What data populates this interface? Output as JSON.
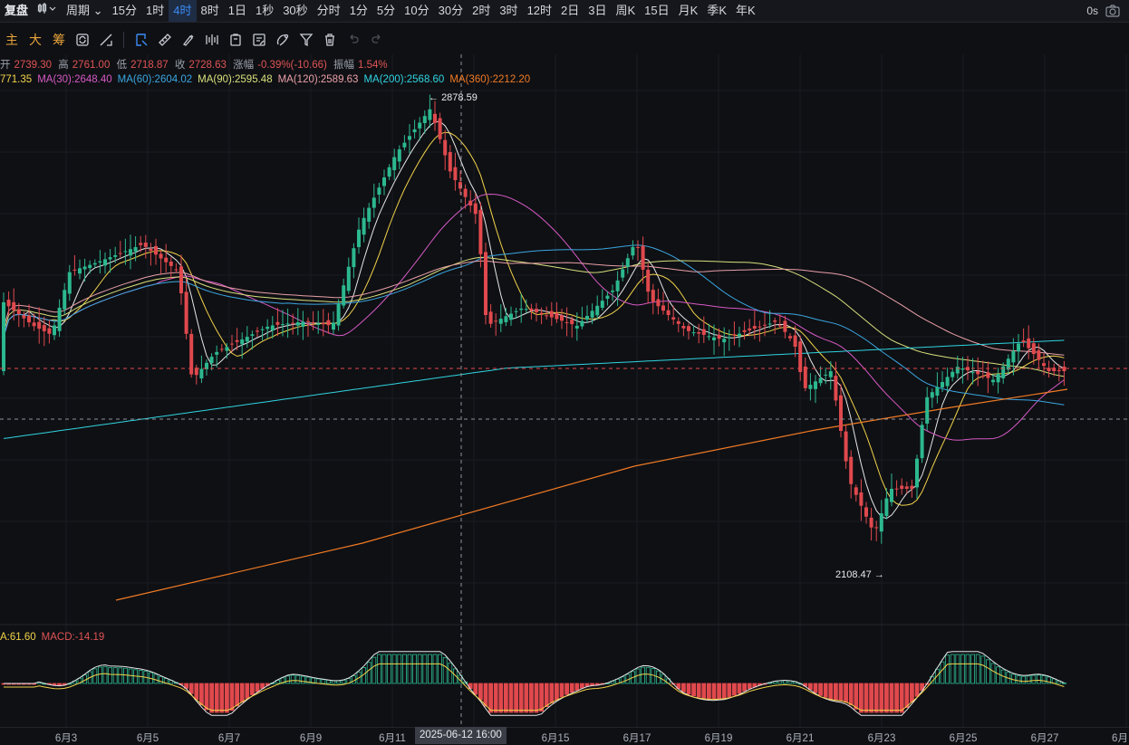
{
  "topbar": {
    "title": "复盘",
    "period_label": "周期",
    "intervals": [
      "15分",
      "1时",
      "4时",
      "8时",
      "1日",
      "1秒",
      "30秒",
      "分时",
      "1分",
      "5分",
      "10分",
      "30分",
      "2时",
      "3时",
      "12时",
      "2日",
      "3日",
      "周K",
      "15日",
      "月K",
      "季K",
      "年K"
    ],
    "active_interval": "4时",
    "latency": "0s"
  },
  "toolbar": {
    "indicator_tabs": [
      "主",
      "大",
      "筹"
    ]
  },
  "ohlc": {
    "open_label": "开",
    "open": "2739.30",
    "high_label": "高",
    "high": "2761.00",
    "low_label": "低",
    "low": "2718.87",
    "close_label": "收",
    "close": "2728.63",
    "change_label": "涨幅",
    "change": "-0.39%(-10.66)",
    "amplitude_label": "振幅",
    "amplitude": "1.54%"
  },
  "ma_row": [
    {
      "text": "771.35",
      "color": "#f2d34a"
    },
    {
      "text": "MA(30):2648.40",
      "color": "#d659c4"
    },
    {
      "text": "MA(60):2604.02",
      "color": "#3aa6e0"
    },
    {
      "text": "MA(90):2595.48",
      "color": "#d8e07c"
    },
    {
      "text": "MA(120):2589.63",
      "color": "#e8a0a8"
    },
    {
      "text": "MA(200):2568.60",
      "color": "#2fd4e0"
    },
    {
      "text": "MA(360):2212.20",
      "color": "#f07a24"
    }
  ],
  "macd_row": [
    {
      "text": "A:61.60",
      "color": "#f2d34a"
    },
    {
      "text": "MACD:-14.19",
      "color": "#e05454"
    }
  ],
  "annotations": {
    "high_mark": "2878.59",
    "low_mark": "2108.47"
  },
  "crosshair_date": "2025-06-12 16:00",
  "xaxis_labels": [
    "6月3",
    "6月5",
    "6月7",
    "6月9",
    "6月11",
    "6月15",
    "6月17",
    "6月19",
    "6月21",
    "6月23",
    "6月25",
    "6月27",
    "6月"
  ],
  "colors": {
    "up": "#2cb88f",
    "down": "#e0494d",
    "accent": "#3b8cf5"
  }
}
